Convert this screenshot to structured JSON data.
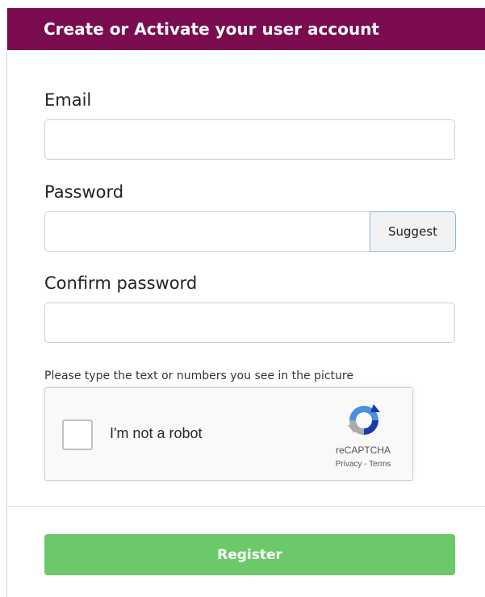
{
  "header": {
    "title": "Create or Activate your user account"
  },
  "form": {
    "email": {
      "label": "Email",
      "value": "",
      "placeholder": ""
    },
    "password": {
      "label": "Password",
      "value": "",
      "placeholder": "",
      "suggest_label": "Suggest"
    },
    "confirm_password": {
      "label": "Confirm password",
      "value": "",
      "placeholder": ""
    },
    "captcha_hint": "Please type the text or numbers you see in the picture"
  },
  "recaptcha": {
    "checkbox_label": "I'm not a robot",
    "brand": "reCAPTCHA",
    "privacy_link": "Privacy",
    "separator": " - ",
    "terms_link": "Terms",
    "logo_icon": "recaptcha-logo-icon"
  },
  "actions": {
    "register_label": "Register"
  },
  "colors": {
    "header_bg": "#7a0c4f",
    "register_bg": "#6cc96a",
    "suggest_border": "#8fb3d9"
  }
}
